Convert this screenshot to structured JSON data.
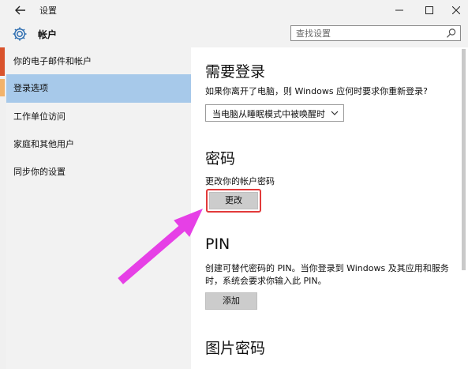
{
  "window": {
    "title": "设置",
    "back_icon": "back-arrow-icon",
    "controls": [
      "minimize-icon",
      "maximize-icon",
      "close-icon"
    ]
  },
  "header": {
    "icon": "gear-icon",
    "title": "帐户",
    "search_placeholder": "查找设置"
  },
  "sidebar": {
    "items": [
      {
        "label": "你的电子邮件和帐户",
        "active": false
      },
      {
        "label": "登录选项",
        "active": true
      },
      {
        "label": "工作单位访问",
        "active": false
      },
      {
        "label": "家庭和其他用户",
        "active": false
      },
      {
        "label": "同步你的设置",
        "active": false
      }
    ]
  },
  "main": {
    "sign_in": {
      "heading": "需要登录",
      "description": "如果你离开了电脑，则 Windows 应何时要求你重新登录?",
      "selected_option": "当电脑从睡眠模式中被唤醒时"
    },
    "password": {
      "heading": "密码",
      "description": "更改你的帐户密码",
      "button_label": "更改"
    },
    "pin": {
      "heading": "PIN",
      "description_line1": "创建可替代密码的 PIN。当你登录到 Windows 及其应用和服务",
      "description_line2": "时，系统会要求你输入此 PIN。",
      "button_label": "添加"
    },
    "picture_password": {
      "heading": "图片密码"
    }
  },
  "colors": {
    "accent_selected": "#a7c9ea",
    "highlight_border": "#e23a3a",
    "annotation_arrow": "#e640e6"
  }
}
